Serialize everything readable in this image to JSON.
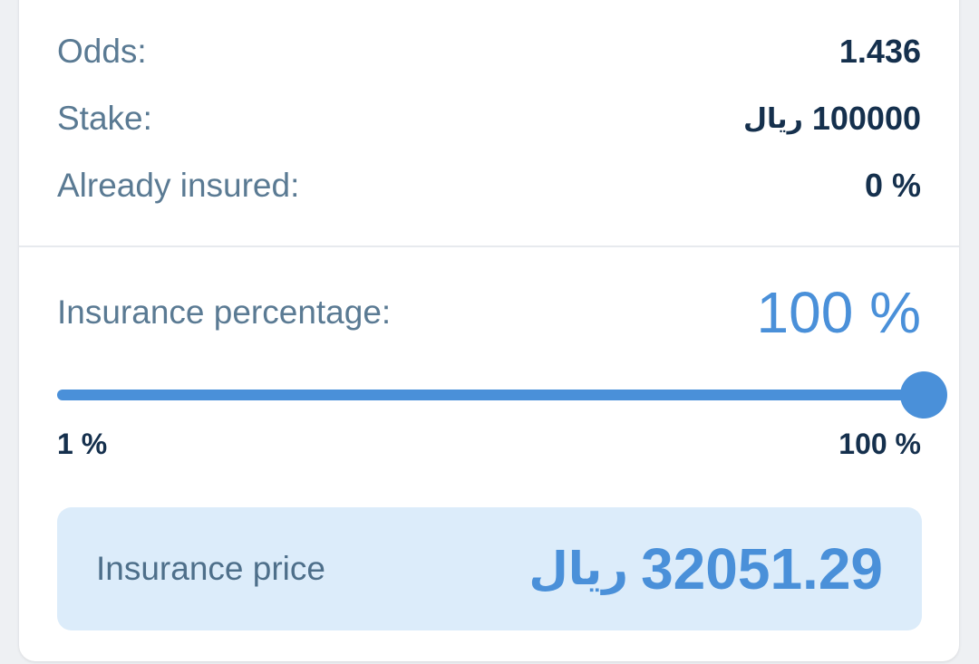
{
  "details": {
    "odds_label": "Odds:",
    "odds_value": "1.436",
    "stake_label": "Stake:",
    "stake_value": "100000",
    "stake_currency": "ریال",
    "insured_label": "Already insured:",
    "insured_value": "0 %"
  },
  "insurance": {
    "percentage_label": "Insurance percentage:",
    "percentage_value": "100 %",
    "slider_fraction": 1.0,
    "min_label": "1 %",
    "max_label": "100 %"
  },
  "price": {
    "label": "Insurance price",
    "value": "32051.29",
    "currency": "ریال"
  },
  "colors": {
    "accent": "#4a90d9",
    "dark_text": "#15304d",
    "muted_text": "#5a7a93",
    "price_bg": "#dcecfa"
  }
}
